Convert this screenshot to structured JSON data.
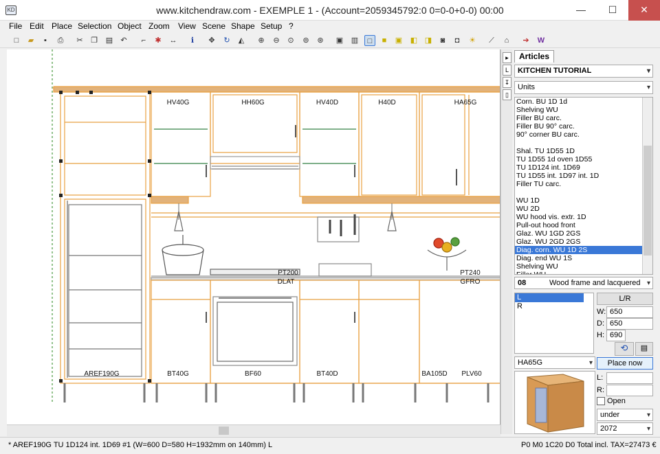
{
  "window": {
    "title": "www.kitchendraw.com - EXEMPLE 1 - (Account=2059345792:0 0=0-0+0-0) 00:00",
    "app_icon": "KD",
    "minimize": "—",
    "maximize": "☐",
    "close": "✕"
  },
  "menu": [
    "File",
    "Edit",
    "Place",
    "Selection",
    "Object",
    "Zoom",
    "View",
    "Scene",
    "Shape",
    "Setup",
    "?"
  ],
  "toolbar_icons": [
    "new-icon",
    "open-icon",
    "save-icon",
    "print-icon",
    "cut-icon",
    "copy-icon",
    "paste-icon",
    "undo-icon",
    "stairs-icon",
    "pin-icon",
    "dimension-icon",
    "info-icon",
    "move-icon",
    "rotate-icon",
    "mirror-icon",
    "zoom-in-icon",
    "zoom-out-icon",
    "zoom-fit-icon",
    "zoom-window-icon",
    "zoom-all-icon",
    "plan-view-icon",
    "elevation-view-icon",
    "box-view-icon",
    "solid-view-icon",
    "cube-view-icon",
    "camera-icon",
    "photo-icon",
    "render-icon",
    "light-icon",
    "measure-icon",
    "house-icon",
    "arrow-icon",
    "wizard-icon"
  ],
  "canvas": {
    "labels": {
      "hv40g": "HV40G",
      "hh60g": "HH60G",
      "hv40d": "HV40D",
      "h40d": "H40D",
      "ha65g": "HA65G",
      "pt200": "PT200",
      "dlat": "DLAT",
      "pt240": "PT240",
      "gfro": "GFRO",
      "aref190g": "AREF190G",
      "bt40g": "BT40G",
      "bf60": "BF60",
      "bt40d": "BT40D",
      "ba105d": "BA105D",
      "plv60": "PLV60"
    }
  },
  "sidebar": {
    "tab": "Articles",
    "catalog": "KITCHEN TUTORIAL",
    "category": "Units",
    "articles": [
      "Corn. BU 1D 1d",
      "Shelving WU",
      "Filler BU carc.",
      "Filler BU 90° carc.",
      "90° corner BU carc.",
      "",
      "Shal. TU 1D55 1D",
      "TU 1D55 1d oven 1D55",
      "TU 1D124 int. 1D69",
      "TU 1D55 int. 1D97 int. 1D",
      "Filler TU carc.",
      "",
      "WU 1D",
      "WU 2D",
      "WU hood vis. extr. 1D",
      "Pull-out hood front",
      "Glaz. WU 1GD 2GS",
      "Glaz. WU 2GD 2GS",
      "Diag. corn. WU 1D 2S",
      "Diag. end WU 1S",
      "Shelving WU",
      "Filler WU"
    ],
    "selected_article": "Diag. corn. WU 1D 2S",
    "finish_code": "08",
    "finish_name": "Wood frame and lacquered par",
    "lr_options": [
      "L",
      "R"
    ],
    "lr_selected": "L",
    "lr_button": "L/R",
    "dim_w_label": "W:",
    "dim_w": "650",
    "dim_d_label": "D:",
    "dim_d": "650",
    "dim_h_label": "H:",
    "dim_h": "690",
    "model_ref": "HA65G",
    "place_now": "Place now",
    "l_label": "L:",
    "r_label": "R:",
    "open_label": "Open",
    "position": "under",
    "height_value": "2072"
  },
  "status": {
    "left": "* AREF190G  TU 1D124 int.  1D69 #1  (W=600 D=580 H=1932mm on 140mm) L",
    "right": "P0 M0 1C20 D0 Total incl. TAX=27473 €"
  },
  "colors": {
    "wood": "#d89a55",
    "outline_orange": "#e8a040",
    "selection_blue": "#3a78d7",
    "glass_green": "#7fb08a"
  }
}
